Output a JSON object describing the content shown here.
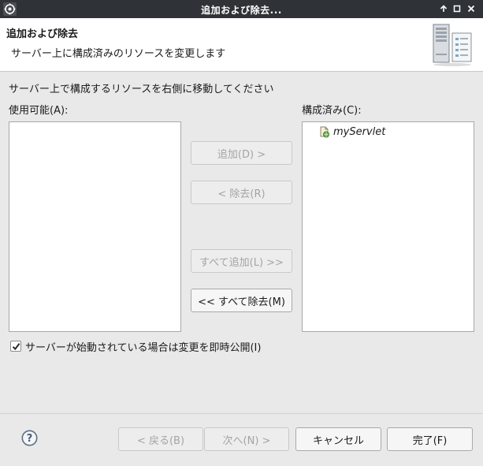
{
  "window": {
    "title": "追加および除去...",
    "controls": [
      "pin-icon",
      "maximize-icon",
      "close-icon"
    ]
  },
  "banner": {
    "title": "追加および除去",
    "description": "サーバー上に構成済みのリソースを変更します",
    "image": "server-icon"
  },
  "instruction": "サーバー上で構成するリソースを右側に移動してください",
  "available": {
    "label": "使用可能(A):",
    "items": []
  },
  "configured": {
    "label": "構成済み(C):",
    "items": [
      {
        "label": "myServlet",
        "icon": "web-module-icon"
      }
    ]
  },
  "buttons": {
    "add": "追加(D) >",
    "remove": "< 除去(R)",
    "add_all": "すべて追加(L) >>",
    "remove_all": "<< すべて除去(M)"
  },
  "publish": {
    "label": "サーバーが始動されている場合は変更を即時公開(I)",
    "checked": true
  },
  "footer": {
    "back": "< 戻る(B)",
    "next": "次へ(N) >",
    "cancel": "キャンセル",
    "finish": "完了(F)",
    "help_icon": "help-icon"
  }
}
